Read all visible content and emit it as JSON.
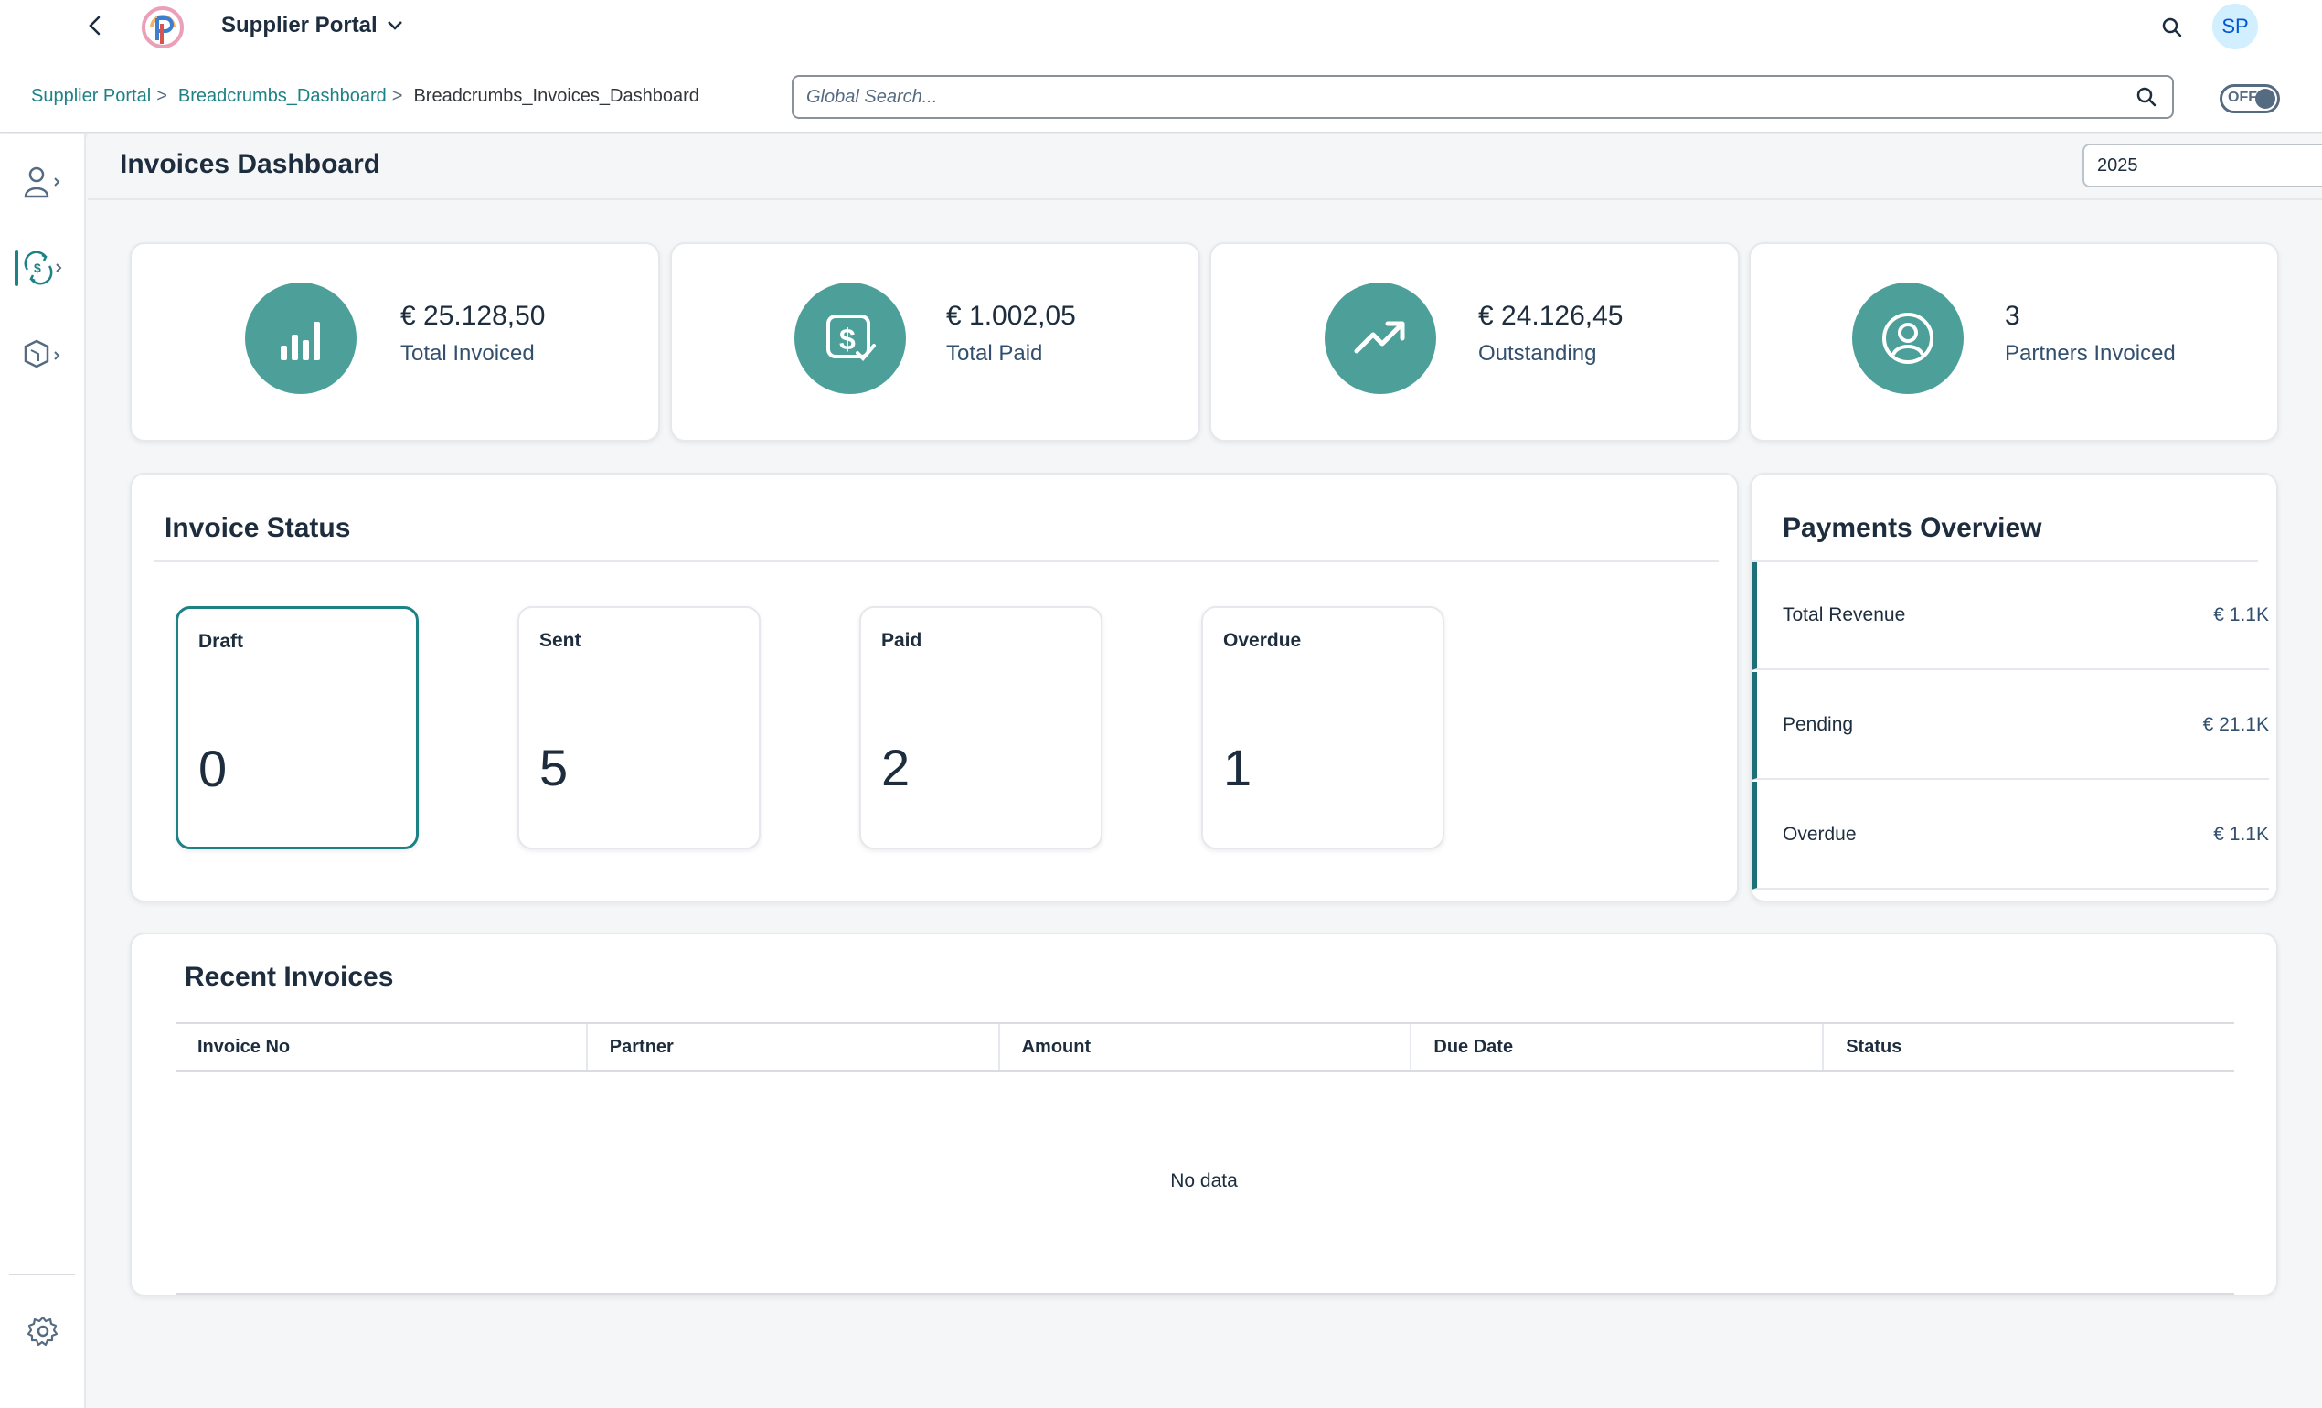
{
  "shell": {
    "app_title": "Supplier Portal",
    "avatar_initials": "SP"
  },
  "breadcrumb": {
    "items": [
      "Supplier Portal",
      "Breadcrumbs_Dashboard"
    ],
    "separator": ">",
    "current": "Breadcrumbs_Invoices_Dashboard"
  },
  "search": {
    "placeholder": "Global Search..."
  },
  "toggle": {
    "label": "OFF"
  },
  "sidenav": {
    "items": [
      {
        "icon": "user-icon"
      },
      {
        "icon": "currency-exchange-icon"
      },
      {
        "icon": "product-icon"
      }
    ],
    "settings_icon": "gear-icon"
  },
  "page": {
    "title": "Invoices Dashboard",
    "year": "2025"
  },
  "kpis": [
    {
      "value": "€ 25.128,50",
      "label": "Total Invoiced",
      "icon": "bar-chart-icon"
    },
    {
      "value": "€ 1.002,05",
      "label": "Total Paid",
      "icon": "paid-invoice-icon"
    },
    {
      "value": "€ 24.126,45",
      "label": "Outstanding",
      "icon": "trend-up-icon"
    },
    {
      "value": "3",
      "label": "Partners Invoiced",
      "icon": "partner-icon"
    }
  ],
  "invoice_status": {
    "title": "Invoice Status",
    "tiles": [
      {
        "label": "Draft",
        "value": "0"
      },
      {
        "label": "Sent",
        "value": "5"
      },
      {
        "label": "Paid",
        "value": "2"
      },
      {
        "label": "Overdue",
        "value": "1"
      }
    ]
  },
  "payments": {
    "title": "Payments Overview",
    "rows": [
      {
        "label": "Total Revenue",
        "value": "€ 1.1K"
      },
      {
        "label": "Pending",
        "value": "€ 21.1K"
      },
      {
        "label": "Overdue",
        "value": "€ 1.1K"
      }
    ]
  },
  "recent": {
    "title": "Recent Invoices",
    "columns": [
      "Invoice No",
      "Partner",
      "Amount",
      "Due Date",
      "Status"
    ],
    "empty_text": "No data"
  },
  "colors": {
    "accent": "#1d8285",
    "kpi_circle": "#4da09a",
    "link": "#1d8285"
  }
}
